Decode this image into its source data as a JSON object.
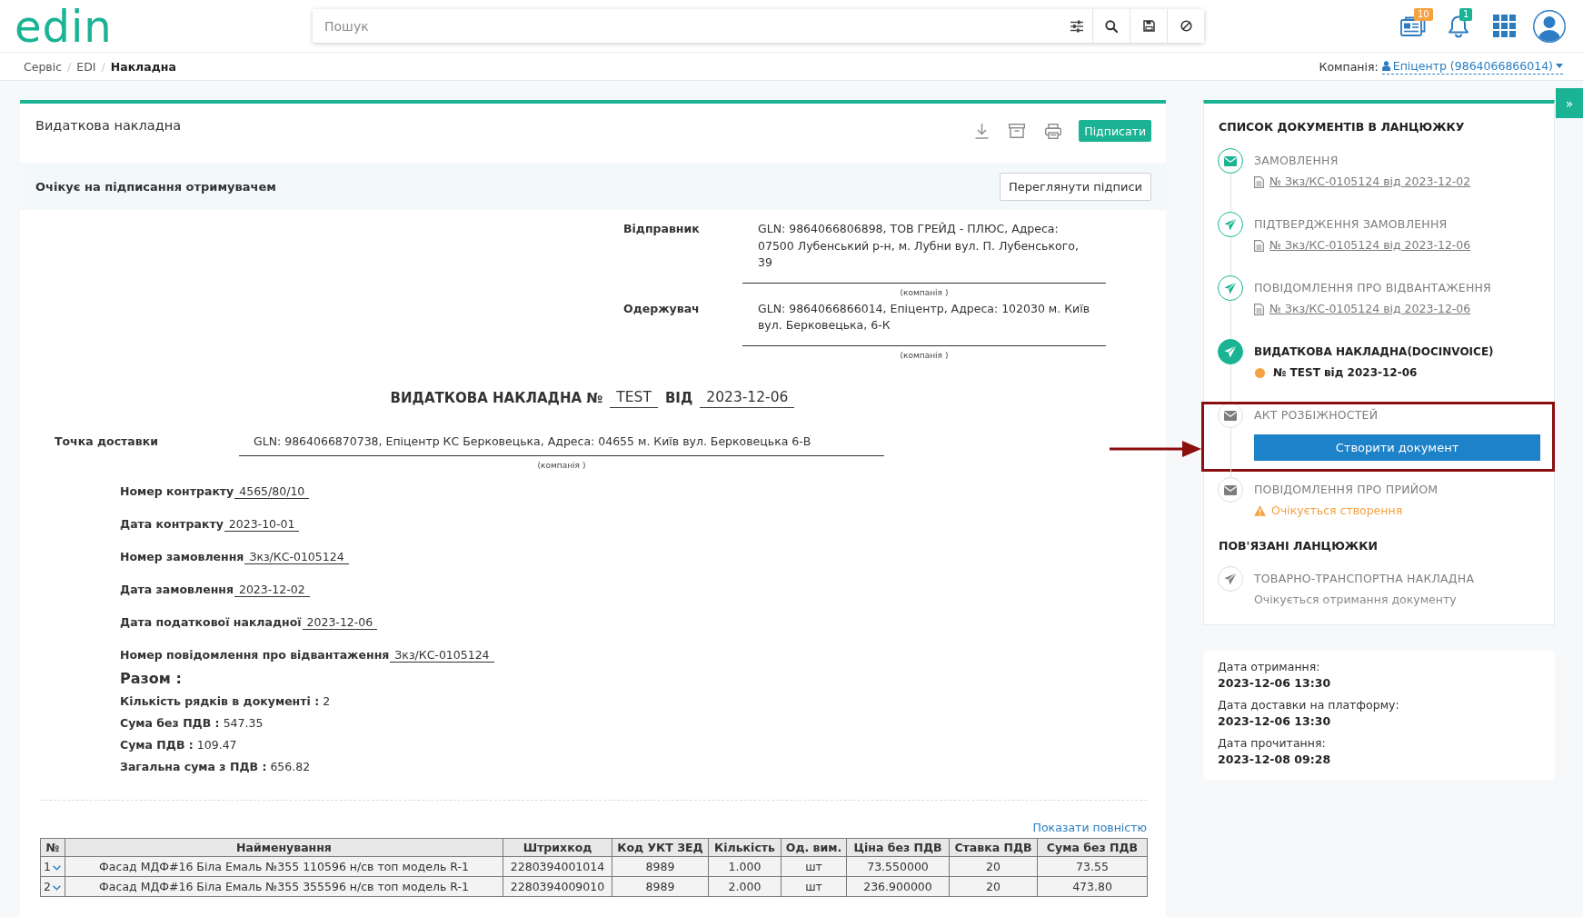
{
  "header": {
    "logo": "edin",
    "search": {
      "placeholder": "Пошук"
    },
    "notifications": [
      {
        "kind": "documents",
        "badge": "10",
        "color": "#f5a240"
      },
      {
        "kind": "bell",
        "badge": "1",
        "color": "#1ab394"
      }
    ]
  },
  "breadcrumbs": {
    "separator": "/",
    "items": [
      {
        "label": "Сервіс",
        "current": false
      },
      {
        "label": "EDI",
        "current": false
      },
      {
        "label": "Накладна",
        "current": true
      }
    ]
  },
  "company": {
    "label": "Компанія:",
    "name": "Епіцентр (9864066866014)"
  },
  "document": {
    "title": "Видаткова накладна",
    "sign_button": "Підписати",
    "status": "Очікує на підписання отримувачем",
    "signatures_button": "Переглянути підписи",
    "parties": [
      {
        "label": "Відправник",
        "value": "GLN: 9864066806898, ТОВ ГРЕЙД - ПЛЮС, Адреса: 07500 Лубенський р-н, м. Лубни вул. П. Лубенського, 39",
        "caption": "(компанія )"
      },
      {
        "label": "Одержувач",
        "value": "GLN: 9864066866014, Епіцентр, Адреса: 102030 м. Київ вул. Берковецька, 6-К",
        "caption": "(компанія )"
      }
    ],
    "heading": {
      "title": "ВИДАТКОВА НАКЛАДНА №",
      "number": "TEST",
      "date_label": "ВІД",
      "date": "2023-12-06"
    },
    "delivery_point": {
      "label": "Точка доставки",
      "value": "GLN: 9864066870738, Епіцентр КС Берковецька, Адреса: 04655 м. Київ вул. Берковецька 6-В",
      "caption": "(компанія )"
    },
    "fields": [
      {
        "label": "Номер контракту",
        "value": "4565/80/10"
      },
      {
        "label": "Дата контракту",
        "value": "2023-10-01"
      },
      {
        "label": "Номер замовлення",
        "value": "Зкз/КС-0105124"
      },
      {
        "label": "Дата замовлення",
        "value": "2023-12-02"
      },
      {
        "label": "Дата податкової накладної",
        "value": "2023-12-06"
      },
      {
        "label": "Номер повідомлення про відвантаження",
        "value": "Зкз/КС-0105124"
      }
    ],
    "totals": {
      "title": "Разом :",
      "items": [
        {
          "label": "Кількість рядків в документі :",
          "value": "2"
        },
        {
          "label": "Сума без ПДВ :",
          "value": "547.35"
        },
        {
          "label": "Сума ПДВ :",
          "value": "109.47"
        },
        {
          "label": "Загальна сума з ПДВ :",
          "value": "656.82"
        }
      ]
    },
    "show_full_link": "Показати повністю",
    "table": {
      "columns": [
        "№",
        "Найменування",
        "Штрихкод",
        "Код УКТ ЗЕД",
        "Кількість",
        "Од. вим.",
        "Ціна без ПДВ",
        "Ставка ПДВ",
        "Сума без ПДВ"
      ],
      "rows": [
        {
          "expanded": false,
          "cells": [
            "1",
            "Фасад МДФ#16 Біла Емаль №355 110596 н/св топ модель R-1",
            "2280394001014",
            "8989",
            "1.000",
            "шт",
            "73.550000",
            "20",
            "73.55"
          ]
        },
        {
          "expanded": false,
          "cells": [
            "2",
            "Фасад МДФ#16 Біла Емаль №355 355596 н/св топ модель R-1",
            "2280394009010",
            "8989",
            "2.000",
            "шт",
            "236.900000",
            "20",
            "473.80"
          ]
        }
      ]
    }
  },
  "chain": {
    "title": "СПИСОК ДОКУМЕНТІВ В ЛАНЦЮЖКУ",
    "items": [
      {
        "title": "ЗАМОВЛЕННЯ",
        "kind": "envelope",
        "completed": true,
        "current": false,
        "highlighted": false,
        "detail": {
          "kind": "link",
          "text": "№ Зкз/КС-0105124 від 2023-12-02"
        }
      },
      {
        "title": "ПІДТВЕРДЖЕННЯ ЗАМОВЛЕННЯ",
        "kind": "plane",
        "completed": true,
        "current": false,
        "highlighted": false,
        "detail": {
          "kind": "link",
          "text": "№ Зкз/КС-0105124 від 2023-12-06"
        }
      },
      {
        "title": "ПОВІДОМЛЕННЯ ПРО ВІДВАНТАЖЕННЯ",
        "kind": "plane",
        "completed": true,
        "current": false,
        "highlighted": false,
        "detail": {
          "kind": "link",
          "text": "№ Зкз/КС-0105124 від 2023-12-06"
        }
      },
      {
        "title": "ВИДАТКОВА НАКЛАДНА(DOCINVOICE)",
        "kind": "plane",
        "completed": true,
        "current": true,
        "highlighted": false,
        "detail": {
          "kind": "current",
          "text": "№ TEST від 2023-12-06"
        }
      },
      {
        "title": "АКТ РОЗБІЖНОСТЕЙ",
        "kind": "envelope",
        "completed": false,
        "current": false,
        "highlighted": true,
        "detail": {
          "kind": "button",
          "text": "Створити документ"
        }
      },
      {
        "title": "ПОВІДОМЛЕННЯ ПРО ПРИЙОМ",
        "kind": "envelope",
        "completed": false,
        "current": false,
        "highlighted": false,
        "detail": {
          "kind": "warning",
          "text": "Очікується створення"
        }
      }
    ]
  },
  "related": {
    "title": "ПОВ'ЯЗАНІ ЛАНЦЮЖКИ",
    "items": [
      {
        "title": "ТОВАРНО-ТРАНСПОРТНА НАКЛАДНА",
        "kind": "plane",
        "completed": false,
        "current": false,
        "detail": {
          "kind": "note",
          "text": "Очікується отримання документу"
        }
      }
    ]
  },
  "dates": [
    {
      "label": "Дата отримання:",
      "value": "2023-12-06 13:30"
    },
    {
      "label": "Дата доставки на платформу:",
      "value": "2023-12-06 13:30"
    },
    {
      "label": "Дата прочитання:",
      "value": "2023-12-08 09:28"
    }
  ],
  "panel_toggle": "»"
}
